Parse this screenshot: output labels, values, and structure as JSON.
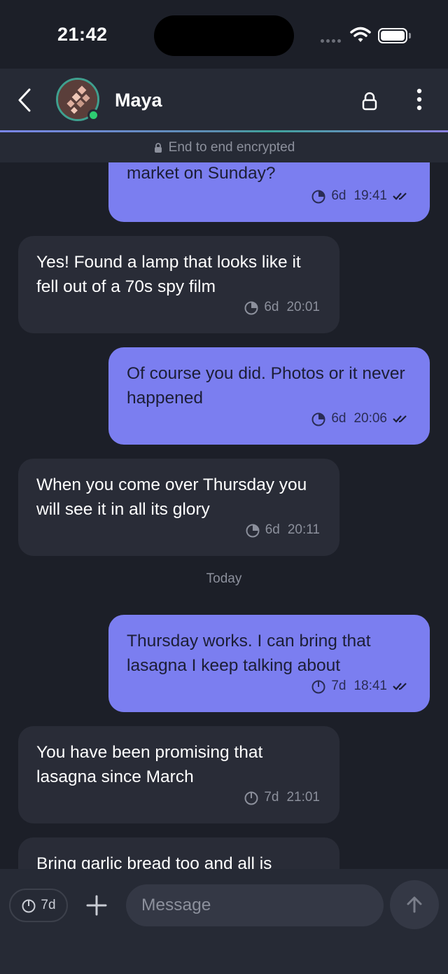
{
  "status_bar": {
    "time": "21:42"
  },
  "header": {
    "contact_name": "Maya",
    "encryption_notice": "End to end encrypted"
  },
  "messages": [
    {
      "direction": "out",
      "text": "market on Sunday?",
      "timer": "6d",
      "time": "19:41",
      "read": true
    },
    {
      "direction": "in",
      "text": "Yes! Found a lamp that looks like it fell out of a 70s spy film",
      "timer": "6d",
      "time": "20:01"
    },
    {
      "direction": "out",
      "text": "Of course you did. Photos or it never happened",
      "timer": "6d",
      "time": "20:06",
      "read": true
    },
    {
      "direction": "in",
      "text": "When you come over Thursday you will see it in all its glory",
      "timer": "6d",
      "time": "20:11"
    },
    {
      "direction": "out",
      "text": "Thursday works. I can bring that lasagna I keep talking about",
      "timer": "7d",
      "time": "18:41",
      "read": true
    },
    {
      "direction": "in",
      "text": "You have been promising that lasagna since March",
      "timer": "7d",
      "time": "21:01"
    },
    {
      "direction": "in",
      "text": "Bring garlic bread too and all is"
    }
  ],
  "day_separator": "Today",
  "composer": {
    "timer_label": "7d",
    "placeholder": "Message"
  },
  "colors": {
    "outgoing_bubble": "#7b7ef0",
    "incoming_bubble": "#292c37",
    "background": "#1c1f28",
    "online": "#2ecc71"
  }
}
